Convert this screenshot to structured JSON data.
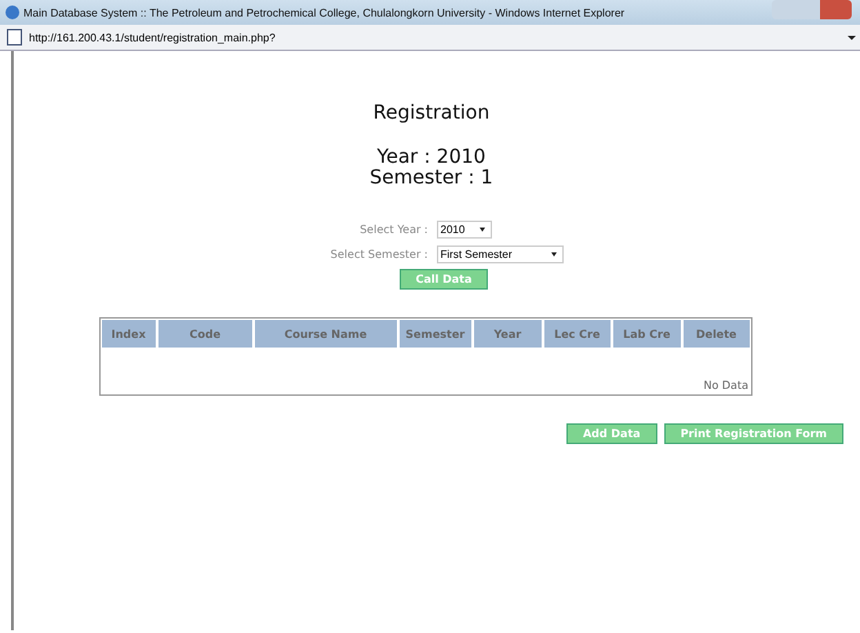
{
  "window": {
    "title": "Main Database System :: The Petroleum and Petrochemical College, Chulalongkorn University - Windows Internet Explorer"
  },
  "address_bar": {
    "url": "http://161.200.43.1/student/registration_main.php?"
  },
  "page": {
    "heading": "Registration",
    "year_line": "Year : 2010",
    "semester_line": "Semester : 1",
    "form": [
      {
        "label": "Select Year :",
        "value": "2010",
        "kind": "short"
      },
      {
        "label": "Select Semester :",
        "value": "First Semester",
        "kind": "long"
      }
    ],
    "call_button": "Call Data",
    "table": {
      "columns": [
        "Index",
        "Code",
        "Course Name",
        "Semester",
        "Year",
        "Lec Cre",
        "Lab Cre",
        "Delete"
      ],
      "empty_text": "No Data"
    },
    "buttons": [
      "Add Data",
      "Print Registration Form"
    ]
  }
}
